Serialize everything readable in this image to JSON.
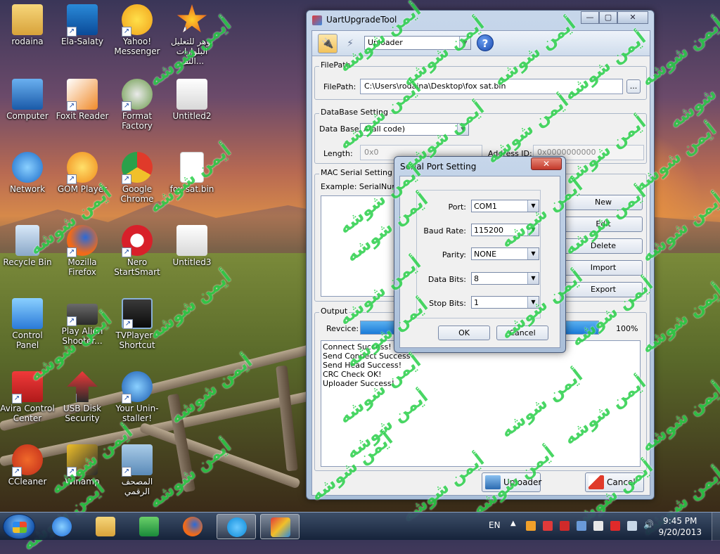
{
  "desktop": {
    "icons": [
      {
        "label": "rodaina"
      },
      {
        "label": "Ela-Salaty"
      },
      {
        "label": "Yahoo! Messenger"
      },
      {
        "label": "بوهر للتعليل البلوارات التف..."
      },
      {
        "label": "Computer"
      },
      {
        "label": "Foxit Reader"
      },
      {
        "label": "Format Factory"
      },
      {
        "label": "Untitled2"
      },
      {
        "label": "Network"
      },
      {
        "label": "GOM Player"
      },
      {
        "label": "Google Chrome"
      },
      {
        "label": "fox sat.bin"
      },
      {
        "label": "Recycle Bin"
      },
      {
        "label": "Mozilla Firefox"
      },
      {
        "label": "Nero StartSmart"
      },
      {
        "label": "Untitled3"
      },
      {
        "label": "Control Panel"
      },
      {
        "label": "Play Alien Shooter..."
      },
      {
        "label": "TVPlayer - Shortcut"
      },
      {
        "label": "Avira Control Center"
      },
      {
        "label": "USB Disk Security"
      },
      {
        "label": "Your Unin-staller!"
      },
      {
        "label": "CCleaner"
      },
      {
        "label": "Winamp"
      },
      {
        "label": "المصحف الرقمي"
      }
    ],
    "watermark": "أيمن شوشه"
  },
  "app": {
    "title": "UartUpgradeTool",
    "window_buttons": {
      "minimize": "—",
      "maximize": "▢",
      "close": "✕"
    },
    "toolbar": {
      "mode_value": "Uploader",
      "help": "?"
    },
    "filepath": {
      "group": "FilePath",
      "label": "FilePath:",
      "value": "C:\\Users\\rodaina\\Desktop\\fox sat.bin",
      "browse": "..."
    },
    "database": {
      "group": "DataBase Setting",
      "db_label": "Data Base:",
      "db_value": "A(all code)",
      "length_label": "Length:",
      "length_value": "0x0",
      "address_label": "Address ID:",
      "address_value": "0x0000000000"
    },
    "mac": {
      "group": "MAC Serial Setting",
      "example": "Example:  SerialNumb",
      "buttons": [
        "New",
        "Edit",
        "Delete",
        "Import",
        "Export"
      ]
    },
    "output": {
      "group": "Output",
      "recvice_label": "Revcice:",
      "progress_percent": 100,
      "progress_text": "100%",
      "log": [
        "Connect Success!",
        "Send Connect Success",
        "Send Head Success!",
        "CRC Check OK!",
        "Uploader Success!"
      ]
    },
    "footer": {
      "uploader": "Uploader",
      "cancel": "Cancel"
    }
  },
  "dialog": {
    "title": "Serial Port Setting",
    "close": "✕",
    "fields": [
      {
        "label": "Port:",
        "value": "COM1"
      },
      {
        "label": "Baud Rate:",
        "value": "115200"
      },
      {
        "label": "Parity:",
        "value": "NONE"
      },
      {
        "label": "Data Bits:",
        "value": "8"
      },
      {
        "label": "Stop Bits:",
        "value": "1"
      }
    ],
    "ok": "OK",
    "cancel": "Cancel"
  },
  "taskbar": {
    "language": "EN",
    "time": "9:45 PM",
    "date": "9/20/2013"
  }
}
